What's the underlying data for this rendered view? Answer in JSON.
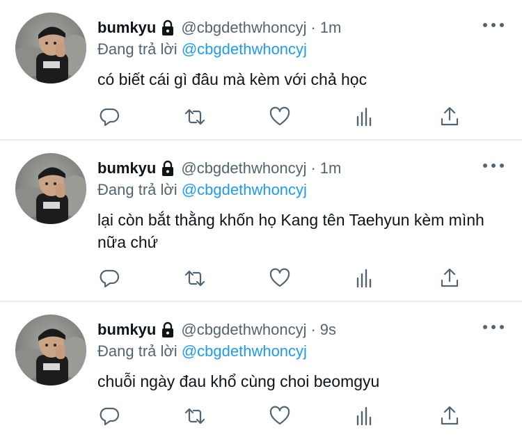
{
  "tweets": [
    {
      "name": "bumkyu",
      "handle": "@cbgdethwhoncyj",
      "separator": "·",
      "time": "1m",
      "reply_prefix": "Đang trả lời",
      "reply_to": "@cbgdethwhoncyj",
      "text": "có biết cái gì đâu mà kèm với chả học"
    },
    {
      "name": "bumkyu",
      "handle": "@cbgdethwhoncyj",
      "separator": "·",
      "time": "1m",
      "reply_prefix": "Đang trả lời",
      "reply_to": "@cbgdethwhoncyj",
      "text": "lại còn bắt thằng khốn họ Kang tên Taehyun kèm mình nữa chứ"
    },
    {
      "name": "bumkyu",
      "handle": "@cbgdethwhoncyj",
      "separator": "·",
      "time": "9s",
      "reply_prefix": "Đang trả lời",
      "reply_to": "@cbgdethwhoncyj",
      "text": "chuỗi ngày đau khổ cùng choi beomgyu"
    }
  ],
  "icons": {
    "lock": "lock-icon",
    "more": "more-icon",
    "reply": "reply-icon",
    "retweet": "retweet-icon",
    "like": "heart-icon",
    "stats": "stats-icon",
    "share": "share-icon"
  },
  "colors": {
    "text": "#0f1419",
    "muted": "#536471",
    "link": "#1d9bf0",
    "divider": "#e6ecf0"
  }
}
